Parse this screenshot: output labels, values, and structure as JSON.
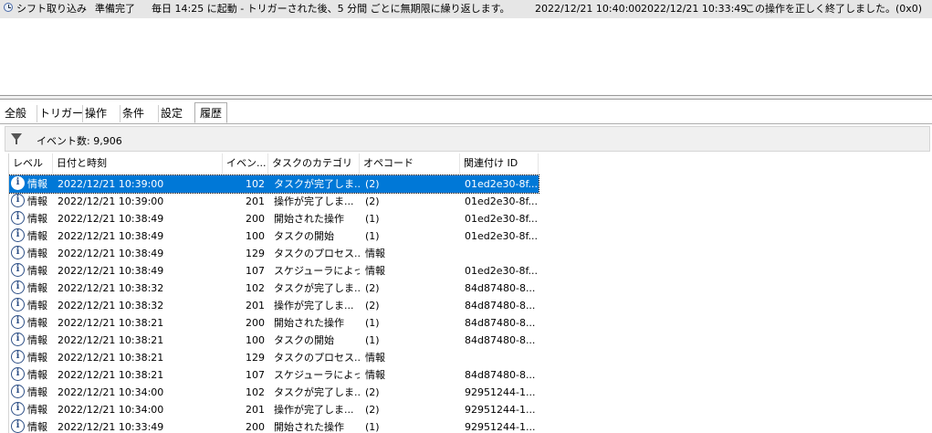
{
  "task": {
    "name": "シフト取り込み",
    "status": "準備完了",
    "trigger": "毎日 14:25 に起動 - トリガーされた後、5 分間 ごとに無期限に繰り返します。",
    "next_run": "2022/12/21 10:40:00",
    "last_run": "2022/12/21 10:33:49",
    "last_result": "この操作を正しく終了しました。(0x0)"
  },
  "tabs": [
    "全般",
    "トリガー",
    "操作",
    "条件",
    "設定",
    "履歴"
  ],
  "active_tab": "履歴",
  "filter": {
    "event_count": "イベント数: 9,906"
  },
  "columns": [
    "レベル",
    "日付と時刻",
    "イベン...",
    "タスクのカテゴリ",
    "オペコード",
    "関連付け ID"
  ],
  "rows": [
    {
      "level": "情報",
      "date": "2022/12/21 10:39:00",
      "event": "102",
      "category": "タスクが完了しま...",
      "opcode": "(2)",
      "id": "01ed2e30-8f..."
    },
    {
      "level": "情報",
      "date": "2022/12/21 10:39:00",
      "event": "201",
      "category": "操作が完了しま...",
      "opcode": "(2)",
      "id": "01ed2e30-8f..."
    },
    {
      "level": "情報",
      "date": "2022/12/21 10:38:49",
      "event": "200",
      "category": "開始された操作",
      "opcode": "(1)",
      "id": "01ed2e30-8f..."
    },
    {
      "level": "情報",
      "date": "2022/12/21 10:38:49",
      "event": "100",
      "category": "タスクの開始",
      "opcode": "(1)",
      "id": "01ed2e30-8f..."
    },
    {
      "level": "情報",
      "date": "2022/12/21 10:38:49",
      "event": "129",
      "category": "タスクのプロセス...",
      "opcode": "情報",
      "id": ""
    },
    {
      "level": "情報",
      "date": "2022/12/21 10:38:49",
      "event": "107",
      "category": "スケジューラによっ...",
      "opcode": "情報",
      "id": "01ed2e30-8f..."
    },
    {
      "level": "情報",
      "date": "2022/12/21 10:38:32",
      "event": "102",
      "category": "タスクが完了しま...",
      "opcode": "(2)",
      "id": "84d87480-8..."
    },
    {
      "level": "情報",
      "date": "2022/12/21 10:38:32",
      "event": "201",
      "category": "操作が完了しま...",
      "opcode": "(2)",
      "id": "84d87480-8..."
    },
    {
      "level": "情報",
      "date": "2022/12/21 10:38:21",
      "event": "200",
      "category": "開始された操作",
      "opcode": "(1)",
      "id": "84d87480-8..."
    },
    {
      "level": "情報",
      "date": "2022/12/21 10:38:21",
      "event": "100",
      "category": "タスクの開始",
      "opcode": "(1)",
      "id": "84d87480-8..."
    },
    {
      "level": "情報",
      "date": "2022/12/21 10:38:21",
      "event": "129",
      "category": "タスクのプロセス...",
      "opcode": "情報",
      "id": ""
    },
    {
      "level": "情報",
      "date": "2022/12/21 10:38:21",
      "event": "107",
      "category": "スケジューラによっ...",
      "opcode": "情報",
      "id": "84d87480-8..."
    },
    {
      "level": "情報",
      "date": "2022/12/21 10:34:00",
      "event": "102",
      "category": "タスクが完了しま...",
      "opcode": "(2)",
      "id": "92951244-1..."
    },
    {
      "level": "情報",
      "date": "2022/12/21 10:34:00",
      "event": "201",
      "category": "操作が完了しま...",
      "opcode": "(2)",
      "id": "92951244-1..."
    },
    {
      "level": "情報",
      "date": "2022/12/21 10:33:49",
      "event": "200",
      "category": "開始された操作",
      "opcode": "(1)",
      "id": "92951244-1..."
    }
  ],
  "selected_row": 0
}
